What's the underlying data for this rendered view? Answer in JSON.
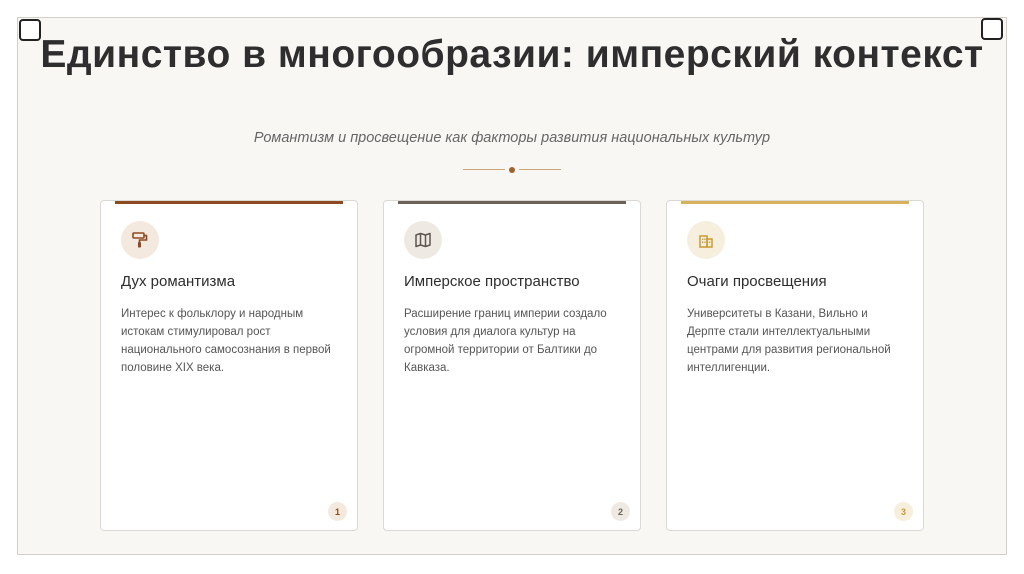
{
  "slide": {
    "title": "Единство в многообразии: имперский контекст",
    "subtitle": "Романтизм и просвещение как факторы развития национальных культур"
  },
  "colors": {
    "accent_brown": "#8b4a22",
    "accent_gray": "#6b625c",
    "accent_gold": "#d7b25c",
    "icon_bg_1": "#f4e9df",
    "icon_bg_2": "#efe9e4",
    "icon_bg_3": "#f6efdd"
  },
  "cards": [
    {
      "icon": "paint-roller-icon",
      "heading": "Дух романтизма",
      "text": "Интерес к фольклору и народным истокам стимулировал рост национального самосознания в первой половине XIX века.",
      "number": "1"
    },
    {
      "icon": "map-icon",
      "heading": "Имперское пространство",
      "text": "Расширение границ империи создало условия для диалога культур на огромной территории от Балтики до Кавказа.",
      "number": "2"
    },
    {
      "icon": "building-icon",
      "heading": "Очаги просвещения",
      "text": "Университеты в Казани, Вильно и Дерпте стали интеллектуальными центрами для развития региональной интеллигенции.",
      "number": "3"
    }
  ]
}
